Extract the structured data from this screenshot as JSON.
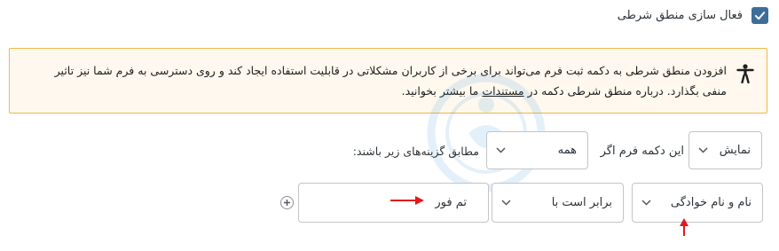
{
  "conditional_logic": {
    "enabled": true,
    "label": "فعال سازی منطق شرطی"
  },
  "notice": {
    "icon": "accessibility-icon",
    "line1": "افزودن منطق شرطی به دکمه ثبت فرم می‌تواند برای برخی از کاربران مشکلاتی در قابلیت استفاده ایجاد کند و روی دسترسی به فرم شما نیز تاثیر",
    "line2_before": "منفی بگذارد. درباره منطق شرطی دکمه در ",
    "link": "مستندات",
    "line2_after": " ما بیشتر بخوانید."
  },
  "rule_header": {
    "action_value": "نمایش",
    "if_text": "این دکمه فرم اگر",
    "match_value": "همه",
    "tail_text": "مطابق گزینه‌های زیر باشند:"
  },
  "rule": {
    "field_value": "نام و نام خوادگی",
    "operator_value": "برابر است با",
    "value": "تم فور"
  },
  "colors": {
    "checkbox": "#3c6e98",
    "notice_border": "#f0b849",
    "notice_bg": "#fef8ee",
    "annotation_arrow": "#e0191d"
  }
}
